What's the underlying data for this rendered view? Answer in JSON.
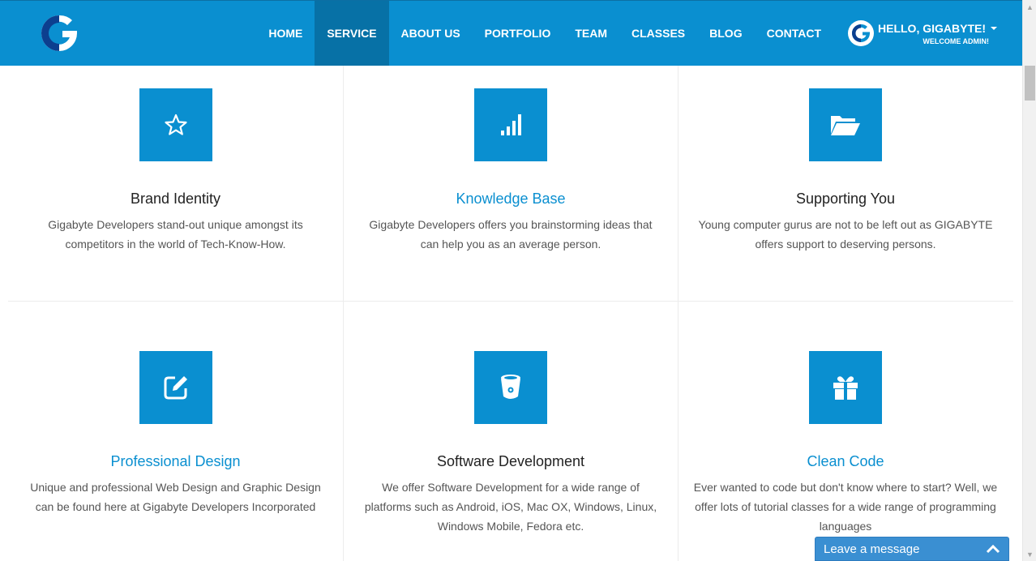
{
  "nav": {
    "items": [
      {
        "label": "HOME",
        "active": false
      },
      {
        "label": "SERVICE",
        "active": true
      },
      {
        "label": "ABOUT US",
        "active": false
      },
      {
        "label": "PORTFOLIO",
        "active": false
      },
      {
        "label": "TEAM",
        "active": false
      },
      {
        "label": "CLASSES",
        "active": false
      },
      {
        "label": "BLOG",
        "active": false
      },
      {
        "label": "CONTACT",
        "active": false
      }
    ],
    "user": {
      "hello": "HELLO, GIGABYTE!",
      "welcome": "WELCOME ADMIN!"
    }
  },
  "services": [
    {
      "icon": "star-icon",
      "title": "Brand Identity",
      "highlight": false,
      "desc": "Gigabyte Developers stand-out unique amongst its competitors in the world of Tech-Know-How."
    },
    {
      "icon": "signal-bars-icon",
      "title": "Knowledge Base",
      "highlight": true,
      "desc": "Gigabyte Developers offers you brainstorming ideas that can help you as an average person."
    },
    {
      "icon": "folder-open-icon",
      "title": "Supporting You",
      "highlight": false,
      "desc": "Young computer gurus are not to be left out as GIGABYTE offers support to deserving persons."
    },
    {
      "icon": "edit-icon",
      "title": "Professional Design",
      "highlight": true,
      "desc": "Unique and professional Web Design and Graphic Design can be found here at Gigabyte Developers Incorporated"
    },
    {
      "icon": "bucket-icon",
      "title": "Software Development",
      "highlight": false,
      "desc": "We offer Software Development for a wide range of platforms such as Android, iOS, Mac OX, Windows, Linux, Windows Mobile, Fedora etc."
    },
    {
      "icon": "gift-icon",
      "title": "Clean Code",
      "highlight": true,
      "desc": "Ever wanted to code but don't know where to start? Well, we offer lots of tutorial classes for a wide range of programming languages"
    }
  ],
  "chat": {
    "label": "Leave a message"
  },
  "colors": {
    "brand": "#0a8fd0",
    "brand_dark": "#0771a6",
    "title": "#222222",
    "text": "#555555",
    "chat": "#3a8fd2"
  }
}
